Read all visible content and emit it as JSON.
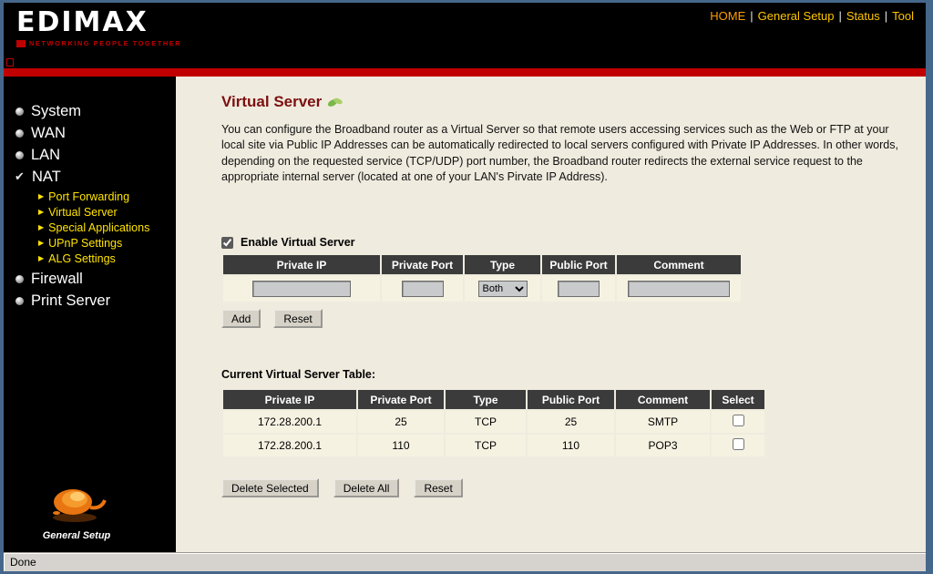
{
  "frame": {
    "status_text": "Done"
  },
  "header": {
    "logo_text": "EDIMAX",
    "logo_tagline": "NETWORKING PEOPLE TOGETHER",
    "nav": [
      {
        "label": "HOME"
      },
      {
        "label": "General Setup"
      },
      {
        "label": "Status"
      },
      {
        "label": "Tool"
      }
    ]
  },
  "icons": {
    "check": "✔",
    "submenu_arrow": "▶",
    "nav_separator": "|"
  },
  "sidebar": {
    "items": [
      {
        "label": "System"
      },
      {
        "label": "WAN"
      },
      {
        "label": "LAN"
      },
      {
        "label": "NAT"
      },
      {
        "label": "Firewall"
      },
      {
        "label": "Print Server"
      }
    ],
    "nat_submenu": [
      {
        "label": "Port Forwarding"
      },
      {
        "label": "Virtual Server"
      },
      {
        "label": "Special Applications"
      },
      {
        "label": "UPnP Settings"
      },
      {
        "label": "ALG Settings"
      }
    ],
    "footer_label": "General Setup"
  },
  "main": {
    "title": "Virtual Server",
    "description": "You can configure the Broadband router as a Virtual Server so that remote users accessing services such as the Web or FTP at your local site via Public IP Addresses can be automatically redirected to local servers configured with Private IP Addresses. In other words, depending on the requested service (TCP/UDP) port number, the Broadband router redirects the external service request to the appropriate internal server (located at one of your LAN's Pirvate IP Address).",
    "enable_label": "Enable Virtual Server",
    "form_table": {
      "headers": [
        "Private IP",
        "Private Port",
        "Type",
        "Public Port",
        "Comment"
      ],
      "type_selected": "Both"
    },
    "form_buttons": {
      "add": "Add",
      "reset": "Reset"
    },
    "current_table": {
      "caption": "Current Virtual Server Table:",
      "headers": [
        "Private IP",
        "Private Port",
        "Type",
        "Public Port",
        "Comment",
        "Select"
      ],
      "rows": [
        {
          "private_ip": "172.28.200.1",
          "private_port": "25",
          "type": "TCP",
          "public_port": "25",
          "comment": "SMTP"
        },
        {
          "private_ip": "172.28.200.1",
          "private_port": "110",
          "type": "TCP",
          "public_port": "110",
          "comment": "POP3"
        }
      ]
    },
    "table_buttons": {
      "delete_selected": "Delete Selected",
      "delete_all": "Delete All",
      "reset": "Reset"
    }
  },
  "colors": {
    "accent_red": "#C00000",
    "title_maroon": "#7C1010",
    "link_yellow": "#FFC600",
    "link_orange": "#FF9D00",
    "content_bg": "#EFEBDE",
    "table_header_bg": "#3B3B3B"
  }
}
